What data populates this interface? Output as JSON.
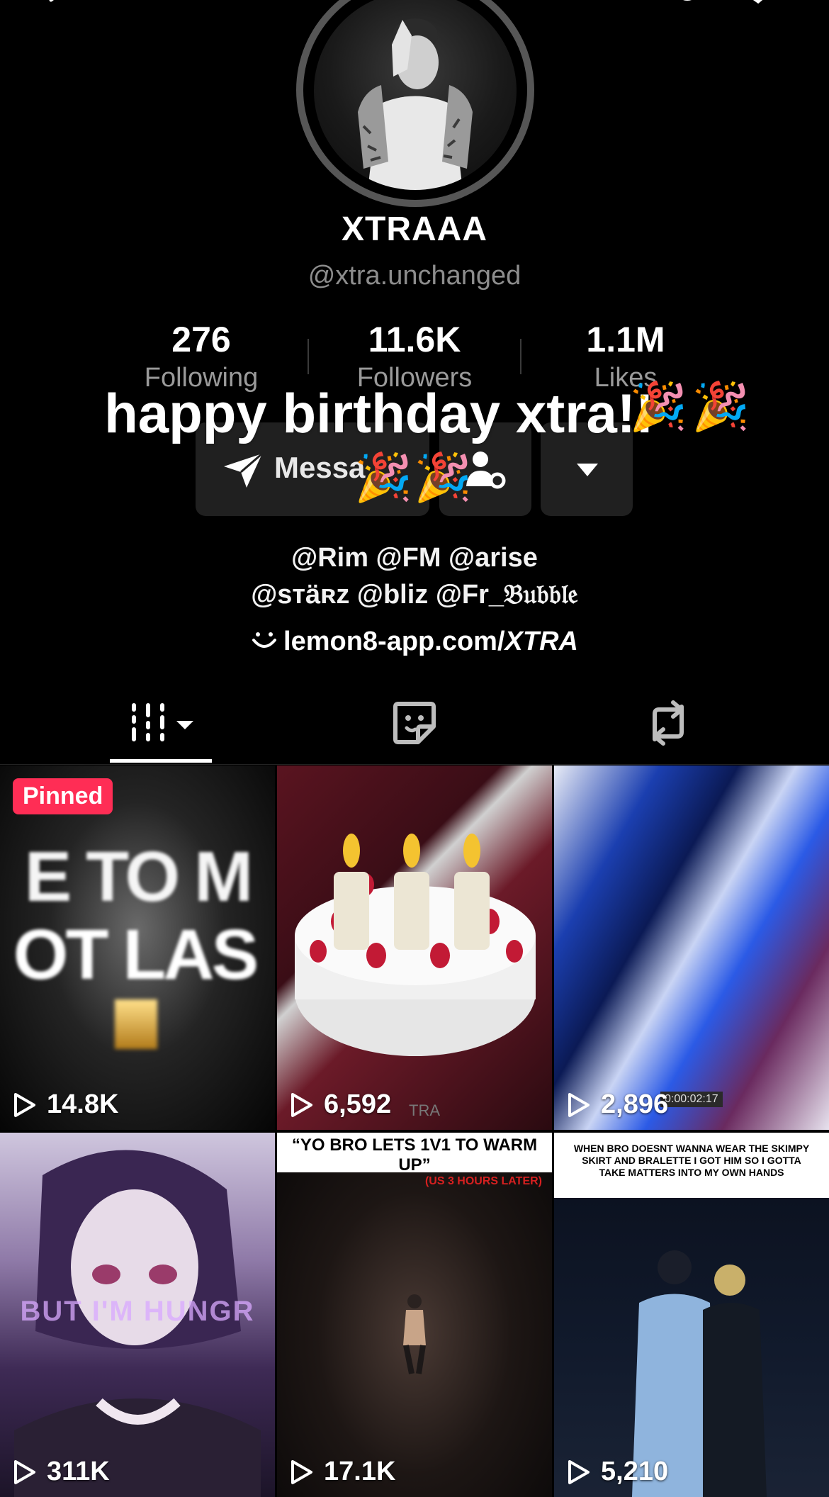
{
  "profile": {
    "display_name": "XTRAAA",
    "username": "@xtra.unchanged",
    "stats": [
      {
        "value": "276",
        "label": "Following"
      },
      {
        "value": "11.6K",
        "label": "Followers"
      },
      {
        "value": "1.1M",
        "label": "Likes"
      }
    ],
    "message_label": "Messa",
    "message_tail": "e",
    "bio_line1": "@Rim @FM @arise",
    "bio_line2": "@sтäʀz @bliz @Fr_𝔅𝔲𝔟𝔟𝔩𝔢",
    "link_text": "lemon8-app.com/",
    "link_text_italic": "XTRA"
  },
  "overlay": {
    "caption": "happy birthday xtra!!",
    "emoji": "🎉"
  },
  "tabs": [
    {
      "icon": "videos-grid-icon"
    },
    {
      "icon": "favorites-sticker-icon"
    },
    {
      "icon": "repost-icon"
    }
  ],
  "videos": [
    {
      "views": "14.8K",
      "pinned_label": "Pinned",
      "overlay_text": "TO / OT LAS",
      "overlay_text_1": "E TO M",
      "overlay_text_2": "OT LAS"
    },
    {
      "views": "6,592",
      "extra_text": "TRA"
    },
    {
      "views": "2,896",
      "timestamp": "0:00:02:17"
    },
    {
      "views": "311K",
      "overlay_text": "BUT I'M HUNGR"
    },
    {
      "views": "17.1K",
      "headline": "“YO BRO LETS 1V1 TO WARM UP”",
      "subline": "(US 3 HOURS LATER)"
    },
    {
      "views": "5,210",
      "headline": "WHEN BRO DOESNT WANNA WEAR THE SKIMPY SKIRT AND BRALETTE I GOT HIM SO I GOTTA TAKE MATTERS INTO MY OWN HANDS"
    }
  ],
  "colors": {
    "background": "#000000",
    "pinned_badge": "#ff2d55",
    "button_bg": "#202020",
    "secondary_text": "#8d8d8d"
  }
}
